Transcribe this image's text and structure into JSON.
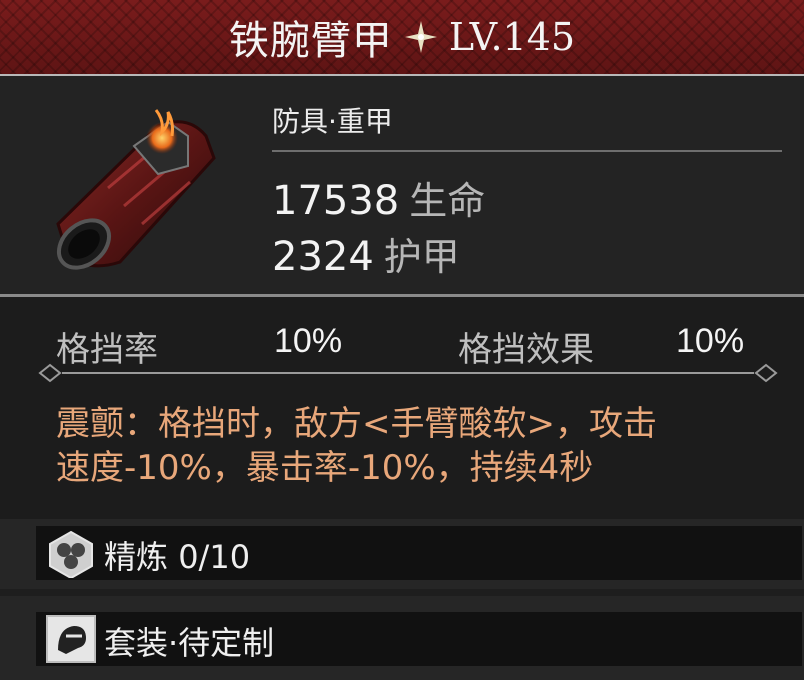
{
  "item": {
    "name": "铁腕臂甲",
    "level": "LV.145",
    "category": "防具·重甲",
    "stats": [
      {
        "value": "17538",
        "unit": "生命"
      },
      {
        "value": "2324",
        "unit": "护甲"
      }
    ]
  },
  "substats": [
    {
      "label": "格挡率",
      "value": "10%"
    },
    {
      "label": "格挡效果",
      "value": "10%"
    }
  ],
  "effect": {
    "line1": "震颤：格挡时，敌方<手臂酸软>，攻击",
    "line2": "速度-10%，暴击率-10%，持续4秒"
  },
  "refine": {
    "label": "精炼",
    "value": "0/10",
    "icon": "refine-hexagon-icon"
  },
  "set": {
    "label": "套装·待定制",
    "icon": "set-armor-icon"
  },
  "colors": {
    "header_red": "#6b1818",
    "effect_text": "#e8a77a",
    "panel": "#232323"
  }
}
